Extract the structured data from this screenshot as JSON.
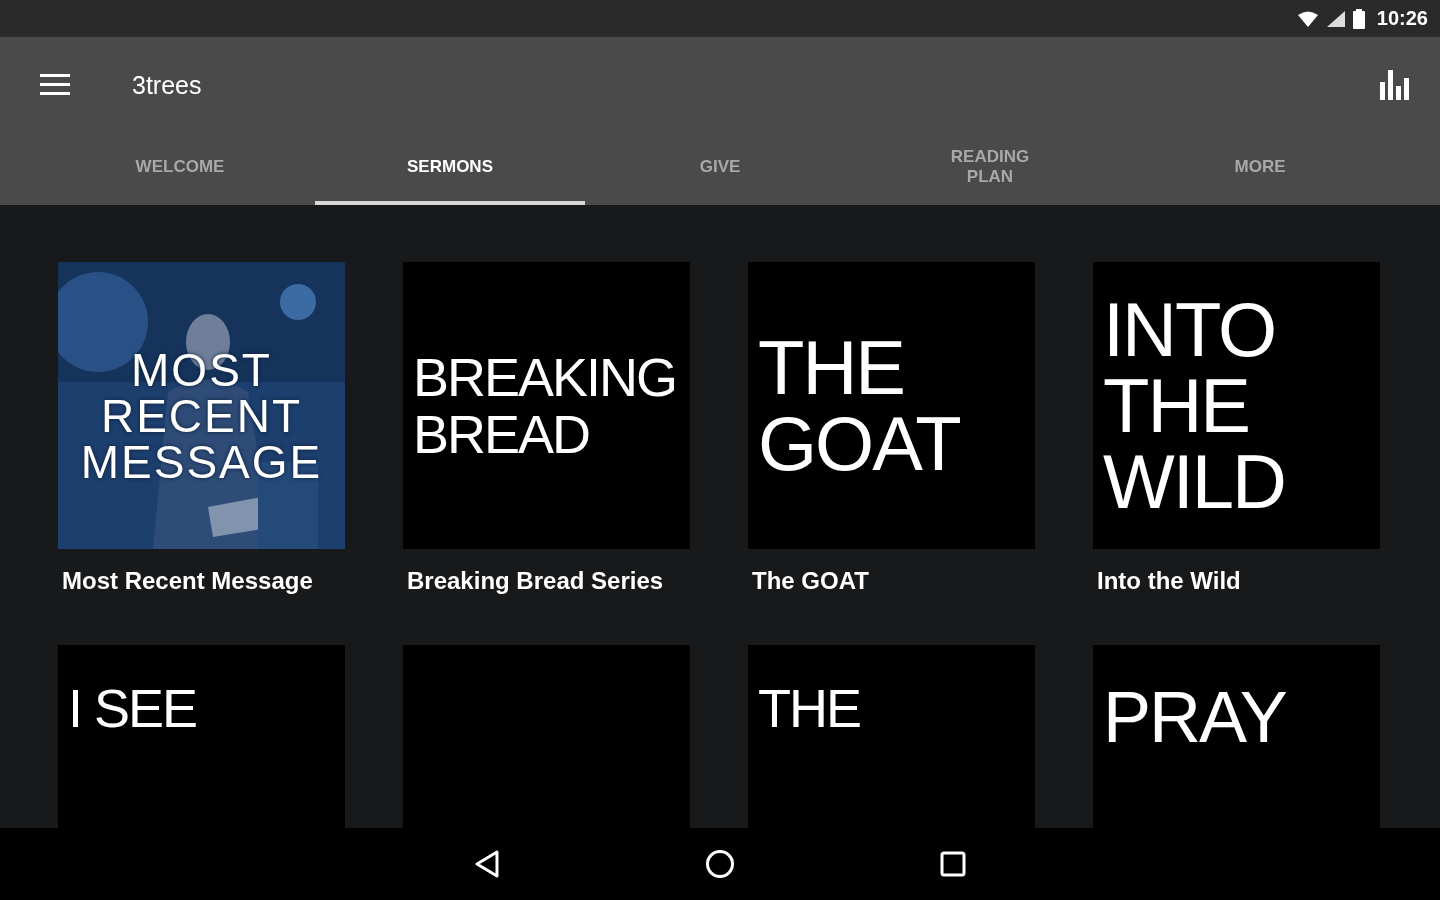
{
  "status_bar": {
    "time": "10:26"
  },
  "app_bar": {
    "title": "3trees"
  },
  "tabs": [
    {
      "label": "WELCOME",
      "selected": false
    },
    {
      "label": "SERMONS",
      "selected": true
    },
    {
      "label": "GIVE",
      "selected": false
    },
    {
      "label": "READING PLAN",
      "selected": false
    },
    {
      "label": "MORE",
      "selected": false
    }
  ],
  "series": [
    {
      "cover_lines": [
        "MOST",
        "RECENT",
        "MESSAGE"
      ],
      "title": "Most Recent Message"
    },
    {
      "kind": "text",
      "cover_lines": [
        "BREAKING",
        "BREAD"
      ],
      "title": "Breaking Bread Series"
    },
    {
      "kind": "text",
      "cover_lines": [
        "THE",
        "GOAT"
      ],
      "title": "The GOAT"
    },
    {
      "kind": "text",
      "cover_lines": [
        "INTO",
        "THE",
        "WILD"
      ],
      "title": "Into the Wild"
    },
    {
      "kind": "text",
      "cover_lines": [
        "I SEE"
      ]
    },
    {
      "kind": "text"
    },
    {
      "kind": "text",
      "cover_lines": [
        "THE"
      ]
    },
    {
      "kind": "text",
      "cover_lines": [
        "PRAY"
      ]
    }
  ]
}
